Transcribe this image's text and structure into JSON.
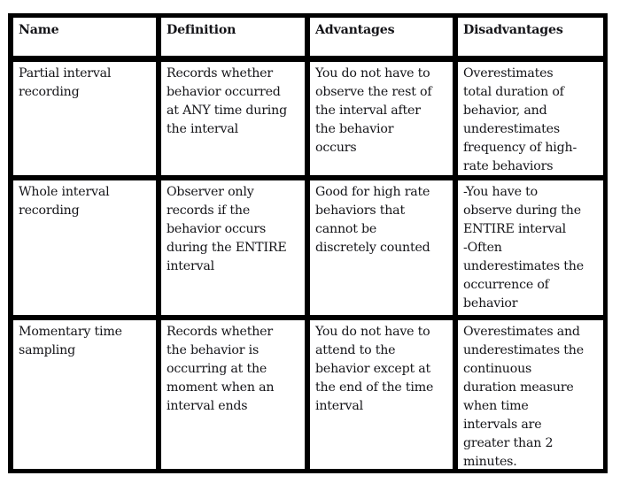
{
  "table": {
    "headers": [
      "Name",
      "Definition",
      "Advantages",
      "Disadvantages"
    ],
    "rows": [
      {
        "name": "Partial interval\nrecording",
        "definition": "Records whether\nbehavior occurred\nat ANY time during\nthe interval",
        "advantages": "You do not have to\nobserve the rest of\nthe interval after\nthe behavior\noccurs",
        "disadvantages": "Overestimates\ntotal duration of\nbehavior, and\nunderestimates\nfrequency of high-\nrate behaviors"
      },
      {
        "name": "Whole interval\nrecording",
        "definition": "Observer only\nrecords if the\nbehavior occurs\nduring the ENTIRE\ninterval",
        "advantages": "Good for high rate\nbehaviors that\ncannot be\ndiscretely counted",
        "disadvantages": "-You have to\nobserve during the\nENTIRE interval\n-Often\nunderestimates the\noccurrence of\nbehavior"
      },
      {
        "name": "Momentary time\nsampling",
        "definition": "Records whether\nthe behavior is\noccurring at the\nmoment when an\ninterval ends",
        "advantages": "You do not have to\nattend to the\nbehavior except at\nthe end of the time\ninterval",
        "disadvantages": "Overestimates and\nunderestimates the\ncontinuous\nduration measure\nwhen time\nintervals are\ngreater than 2\nminutes."
      }
    ]
  }
}
